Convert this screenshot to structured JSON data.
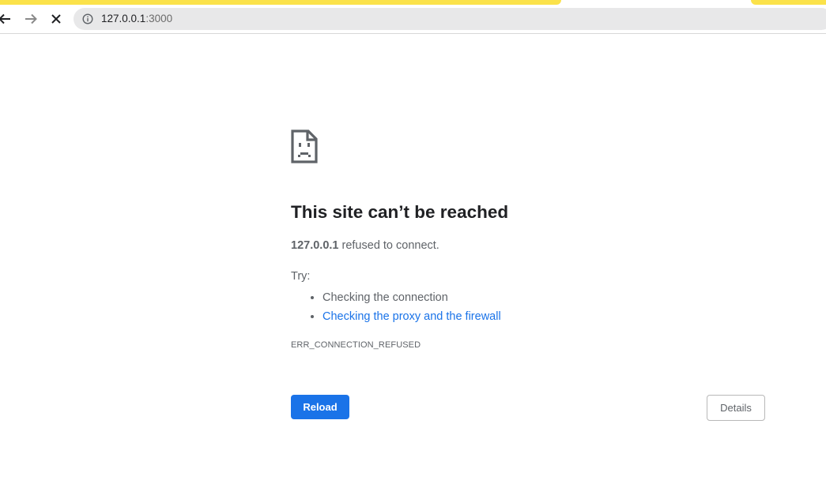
{
  "browser": {
    "url_host": "127.0.0.1",
    "url_port": ":3000",
    "tab_color": "#fbe24a",
    "icons": {
      "back": "back-arrow-icon",
      "forward": "forward-arrow-icon",
      "stop": "stop-x-icon",
      "site_info": "info-icon"
    }
  },
  "error_page": {
    "icon": "sad-document-icon",
    "title": "This site can’t be reached",
    "host": "127.0.0.1",
    "summary_suffix": " refused to connect.",
    "try_label": "Try:",
    "suggestions": [
      {
        "text": "Checking the connection",
        "is_link": false
      },
      {
        "text": "Checking the proxy and the firewall",
        "is_link": true
      }
    ],
    "error_code": "ERR_CONNECTION_REFUSED",
    "reload_label": "Reload",
    "details_label": "Details",
    "accent_color": "#1a73e8"
  }
}
